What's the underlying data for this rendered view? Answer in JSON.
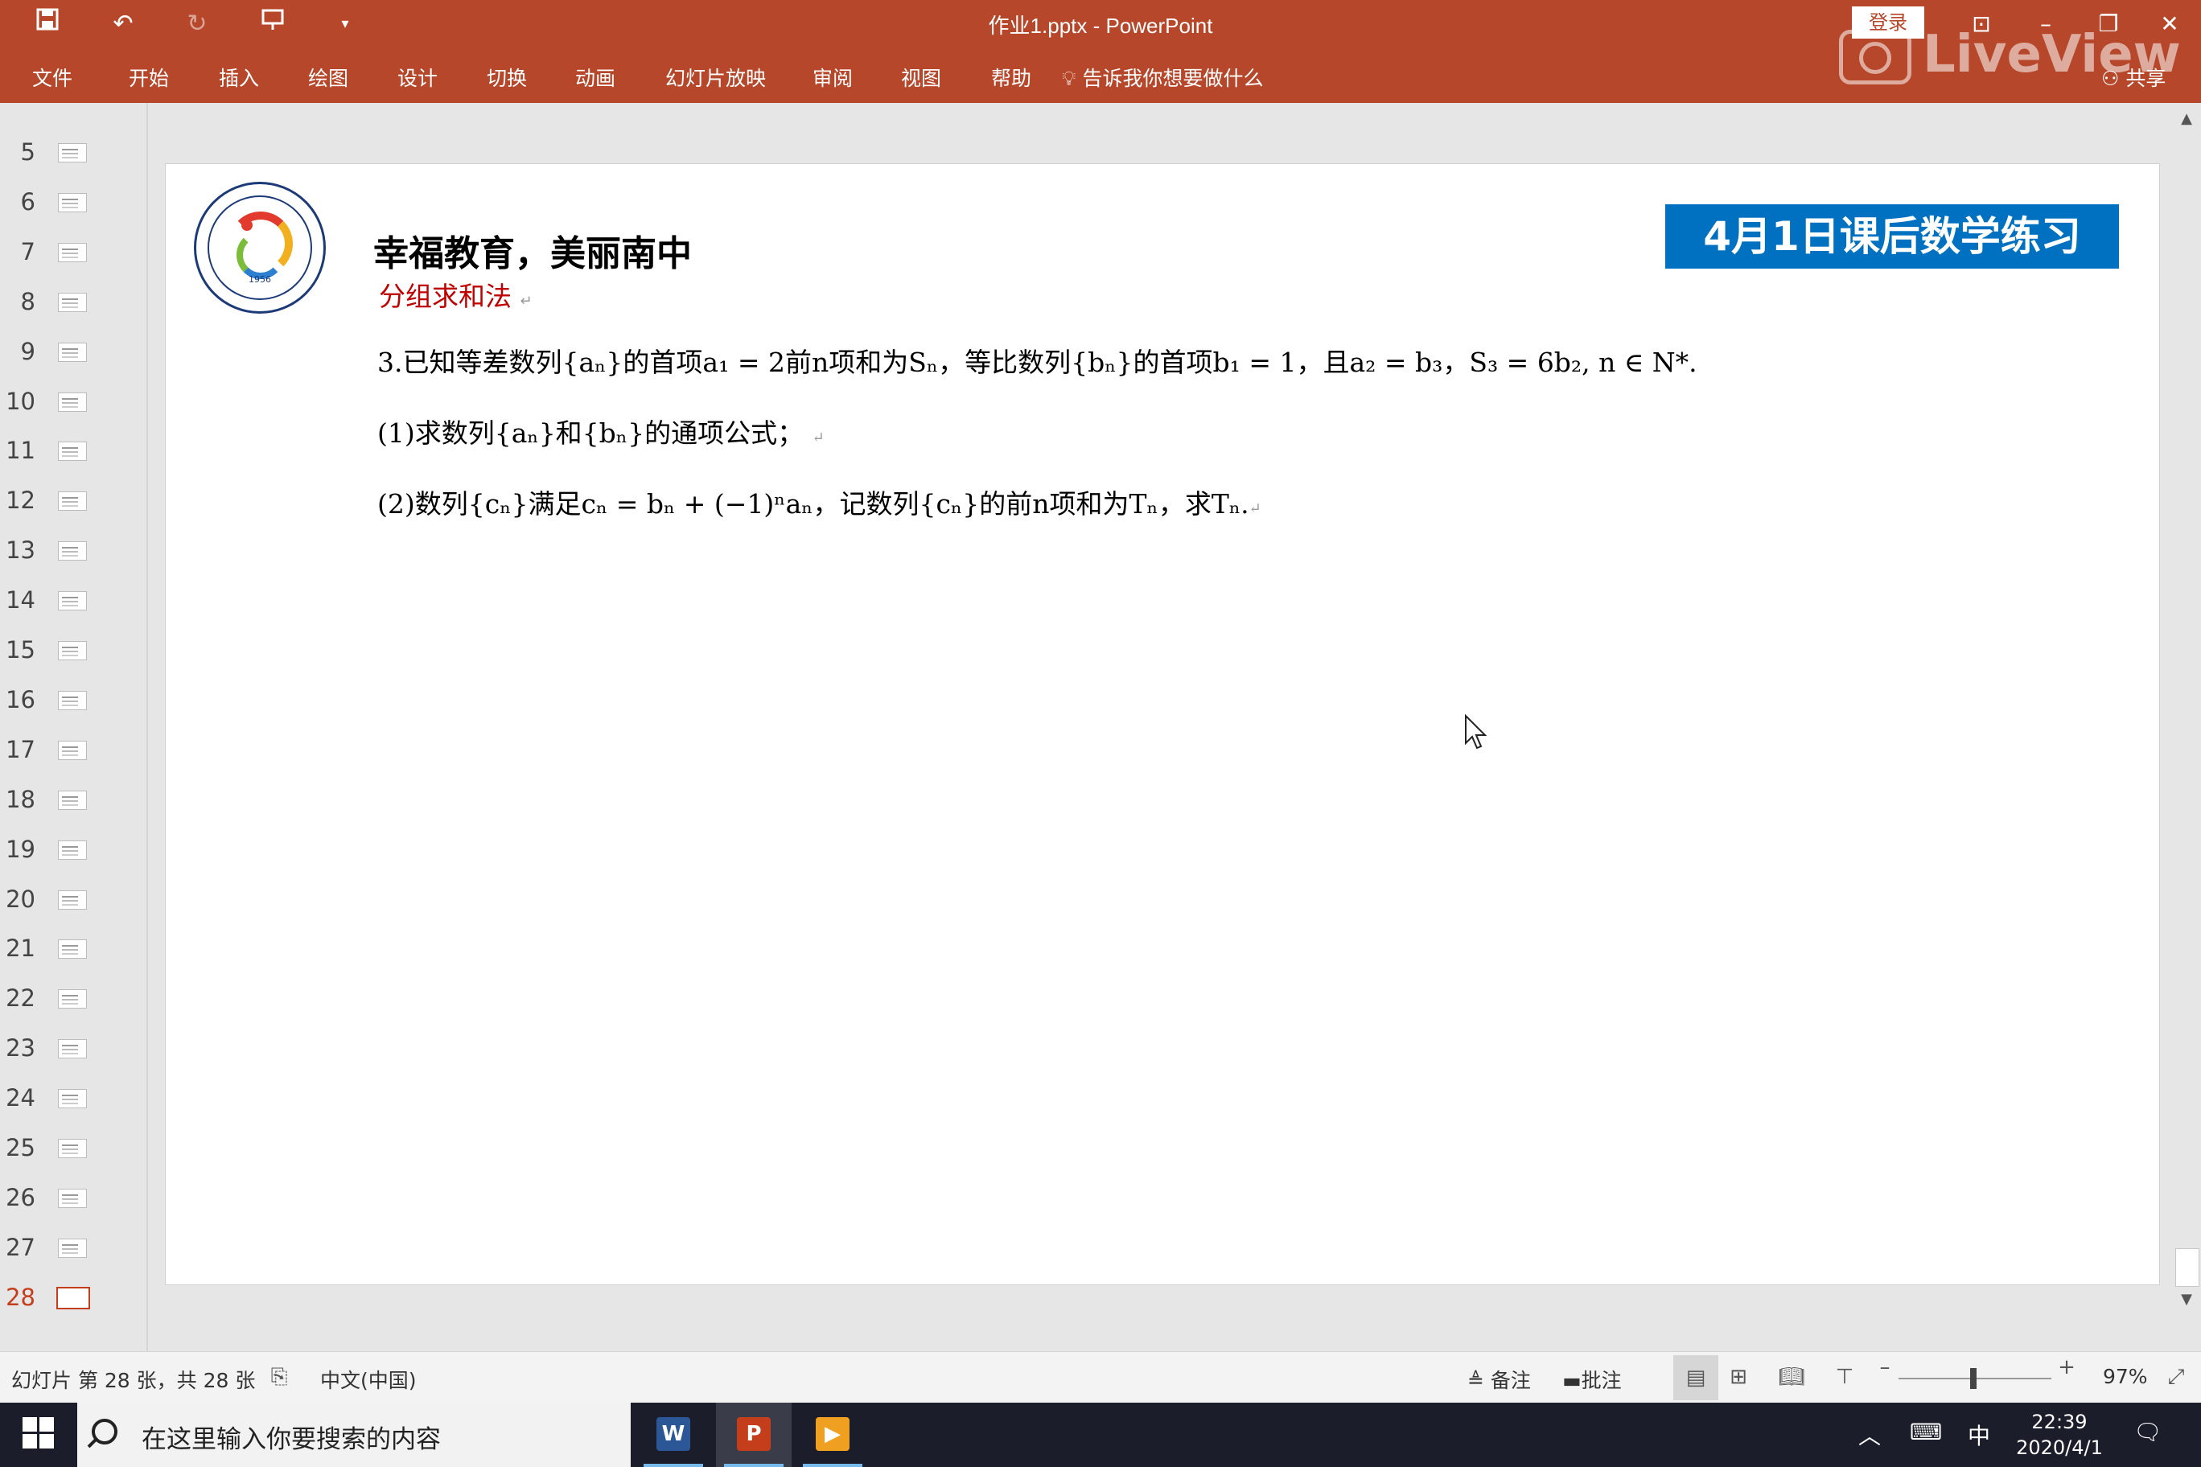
{
  "window": {
    "title": "作业1.pptx  -  PowerPoint",
    "login_label": "登录",
    "watermark": "LiveView",
    "share_label": "共享",
    "quick_access": [
      "save-icon",
      "undo-icon",
      "redo-icon",
      "present-icon",
      "customize-icon"
    ]
  },
  "ribbon": {
    "tabs": [
      "文件",
      "开始",
      "插入",
      "绘图",
      "设计",
      "切换",
      "动画",
      "幻灯片放映",
      "审阅",
      "视图",
      "帮助"
    ],
    "tell_me": "告诉我你想要做什么"
  },
  "thumbnails": {
    "numbers": [
      "5",
      "6",
      "7",
      "8",
      "9",
      "10",
      "11",
      "12",
      "13",
      "14",
      "15",
      "16",
      "17",
      "18",
      "19",
      "20",
      "21",
      "22",
      "23",
      "24",
      "25",
      "26",
      "27",
      "28"
    ],
    "active": "28"
  },
  "slide": {
    "heading": "幸福教育，美丽南中",
    "subheading": "分组求和法",
    "banner": "4月1日课后数学练习",
    "logo_year": "1956",
    "q1": "3.已知等差数列{aₙ}的首项a₁ = 2前n项和为Sₙ，等比数列{bₙ}的首项b₁ = 1，且a₂ = b₃，S₃ = 6b₂, n ∈ N*.",
    "q2": "(1)求数列{aₙ}和{bₙ}的通项公式；",
    "q3": "(2)数列{cₙ}满足cₙ = bₙ + (−1)ⁿaₙ，记数列{cₙ}的前n项和为Tₙ，求Tₙ."
  },
  "statusbar": {
    "slide_info": "幻灯片 第 28 张，共 28 张",
    "language": "中文(中国)",
    "notes": "备注",
    "comments": "批注",
    "zoom": "97%"
  },
  "taskbar": {
    "search_placeholder": "在这里输入你要搜索的内容",
    "ime": "中",
    "time": "22:39",
    "date": "2020/4/1"
  },
  "colors": {
    "accent": "#b7472a",
    "banner": "#0070c0",
    "sub_red": "#c00000"
  }
}
